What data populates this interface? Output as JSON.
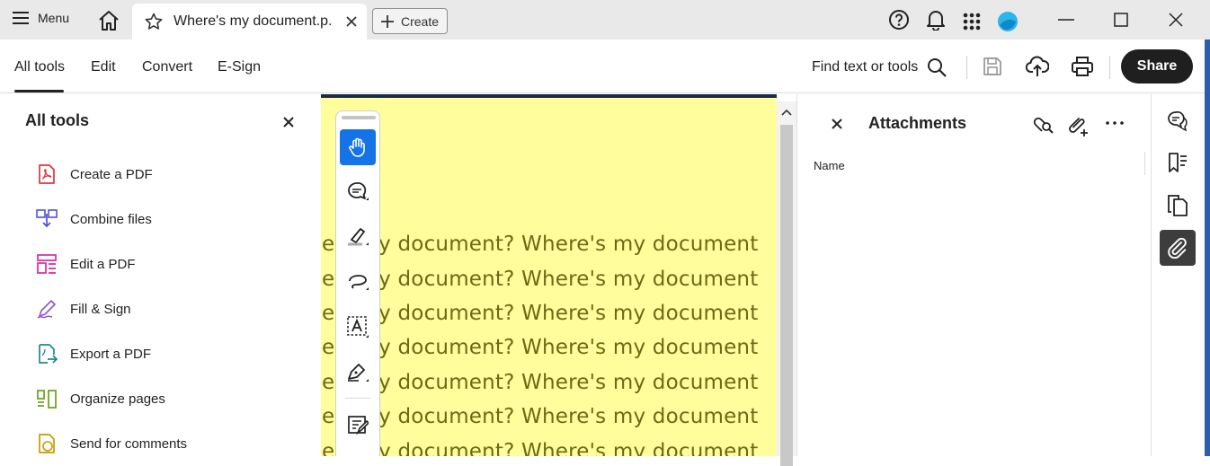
{
  "titlebar": {
    "menu_label": "Menu",
    "tab_title": "Where's my document.p...",
    "create_label": "Create",
    "icons": [
      "help-icon",
      "bell-icon",
      "apps-grid-icon",
      "account-avatar"
    ],
    "window_controls": [
      "minimize",
      "maximize",
      "close"
    ]
  },
  "toolbar": {
    "tabs": [
      "All tools",
      "Edit",
      "Convert",
      "E-Sign"
    ],
    "active_tab": "All tools",
    "find_label": "Find text or tools",
    "share_label": "Share"
  },
  "left_panel": {
    "title": "All tools",
    "items": [
      {
        "label": "Create a PDF",
        "icon": "create-pdf-icon",
        "color": "#d7373f"
      },
      {
        "label": "Combine files",
        "icon": "combine-files-icon",
        "color": "#5151d3"
      },
      {
        "label": "Edit a PDF",
        "icon": "edit-pdf-icon",
        "color": "#d32ba3"
      },
      {
        "label": "Fill & Sign",
        "icon": "fill-sign-icon",
        "color": "#9256d9"
      },
      {
        "label": "Export a PDF",
        "icon": "export-pdf-icon",
        "color": "#1e8a8a"
      },
      {
        "label": "Organize pages",
        "icon": "organize-pages-icon",
        "color": "#6e9e1e"
      },
      {
        "label": "Send for comments",
        "icon": "send-comments-icon",
        "color": "#c99a00"
      }
    ]
  },
  "document": {
    "lines": [
      "e's my document? Where's my document",
      "e's my document? Where's my document",
      "e's my document? Where's my document",
      "e's my document? Where's my document",
      "e's my document? Where's my document",
      "e's my document? Where's my document",
      "e's my document? Where's my document"
    ],
    "background": "#fffd9c",
    "text_color": "#6d6a16"
  },
  "attachments": {
    "title": "Attachments",
    "column_header": "Name"
  },
  "colors": {
    "accent": "#1473e6",
    "share_bg": "#1f1f1f"
  }
}
